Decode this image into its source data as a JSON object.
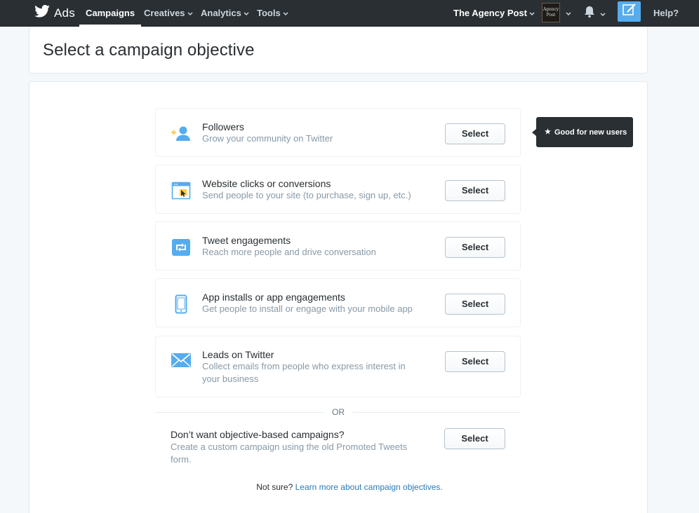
{
  "nav": {
    "brand": "Ads",
    "items": [
      {
        "label": "Campaigns",
        "active": true
      },
      {
        "label": "Creatives",
        "active": false
      },
      {
        "label": "Analytics",
        "active": false
      },
      {
        "label": "Tools",
        "active": false
      }
    ],
    "account": "The Agency Post",
    "avatar_text": "Agency Post",
    "help": "Help?"
  },
  "page": {
    "title": "Select a campaign objective"
  },
  "objectives": [
    {
      "title": "Followers",
      "description": "Grow your community on Twitter",
      "icon": "add-follower-icon",
      "button": "Select"
    },
    {
      "title": "Website clicks or conversions",
      "description": "Send people to your site (to purchase, sign up, etc.)",
      "icon": "browser-window-cursor-icon",
      "button": "Select"
    },
    {
      "title": "Tweet engagements",
      "description": "Reach more people and drive conversation",
      "icon": "retweet-icon",
      "button": "Select"
    },
    {
      "title": "App installs or app engagements",
      "description": "Get people to install or engage with your mobile app",
      "icon": "mobile-phone-icon",
      "button": "Select"
    },
    {
      "title": "Leads on Twitter",
      "description": "Collect emails from people who express interest in your business",
      "icon": "envelope-icon",
      "button": "Select"
    }
  ],
  "tooltip": {
    "icon": "★",
    "text": "Good for new users"
  },
  "separator": "OR",
  "alternative": {
    "title": "Don’t want objective-based campaigns?",
    "description": "Create a custom campaign using the old Promoted Tweets form.",
    "button": "Select"
  },
  "footer": {
    "prefix": "Not sure? ",
    "link": "Learn more about campaign objectives."
  },
  "colors": {
    "nav_bg": "#292f33",
    "accent_blue": "#55acee",
    "link": "#2b7bb9",
    "icon_yellow": "#ffcc4d"
  }
}
